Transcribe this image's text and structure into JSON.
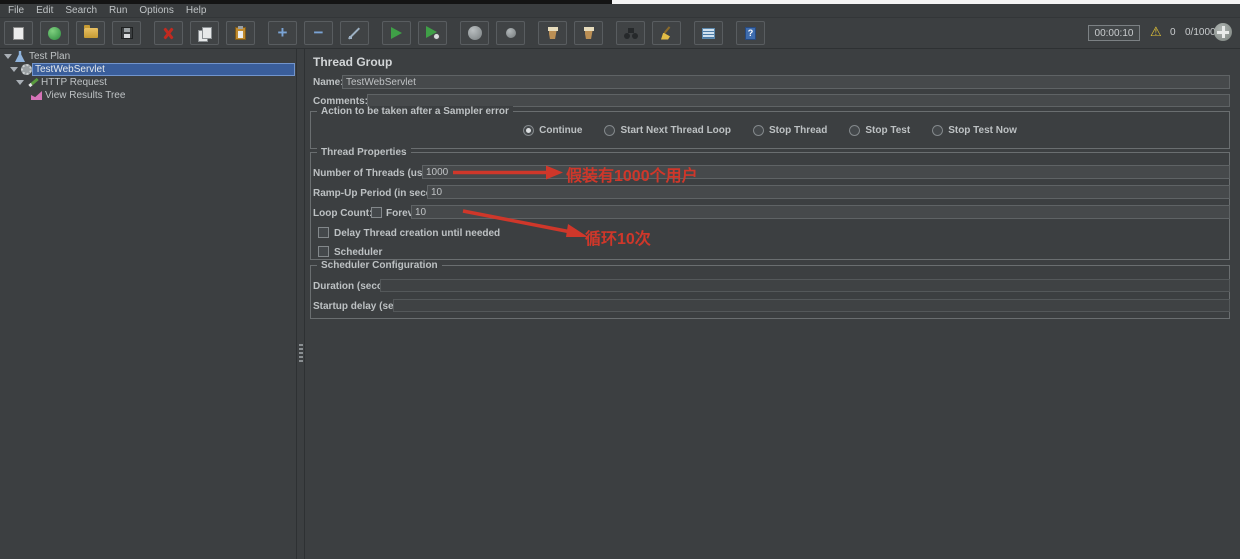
{
  "window": {
    "menu": {
      "items": [
        "File",
        "Edit",
        "Search",
        "Run",
        "Options",
        "Help"
      ]
    },
    "toolbar": {
      "buttons": [
        "new-plan",
        "templates",
        "open",
        "save",
        "cut",
        "copy",
        "paste",
        "expand-all",
        "collapse-all",
        "toggle",
        "start",
        "start-no-pauses",
        "stop",
        "shutdown",
        "clear",
        "clear-all",
        "search",
        "search-reset",
        "function-helper",
        "help"
      ],
      "timer": "00:00:10",
      "warning_count": "0",
      "thread_counter": "0/1000"
    }
  },
  "tree": {
    "items": [
      {
        "label": "Test Plan",
        "icon": "test-plan-icon",
        "selected": false
      },
      {
        "label": "TestWebServlet",
        "icon": "thread-group-icon",
        "selected": true
      },
      {
        "label": "HTTP Request",
        "icon": "http-request-icon",
        "selected": false
      },
      {
        "label": "View Results Tree",
        "icon": "view-results-tree-icon",
        "selected": false
      }
    ]
  },
  "main": {
    "title": "Thread Group",
    "name": {
      "label": "Name:",
      "value": "TestWebServlet"
    },
    "comments": {
      "label": "Comments:",
      "value": ""
    },
    "sampler_error": {
      "legend": "Action to be taken after a Sampler error",
      "options": [
        {
          "label": "Continue",
          "selected": true
        },
        {
          "label": "Start Next Thread Loop",
          "selected": false
        },
        {
          "label": "Stop Thread",
          "selected": false
        },
        {
          "label": "Stop Test",
          "selected": false
        },
        {
          "label": "Stop Test Now",
          "selected": false
        }
      ]
    },
    "thread_properties": {
      "legend": "Thread Properties",
      "num_threads": {
        "label": "Number of Threads (users):",
        "value": "1000"
      },
      "ramp_up": {
        "label": "Ramp-Up Period (in seconds):",
        "value": "10"
      },
      "loop_count": {
        "label": "Loop Count:",
        "forever_label": "Forever",
        "forever_checked": false,
        "value": "10"
      },
      "delay_label": "Delay Thread creation until needed",
      "delay_checked": false,
      "scheduler_label": "Scheduler",
      "scheduler_checked": false
    },
    "scheduler_config": {
      "legend": "Scheduler Configuration",
      "duration": {
        "label": "Duration (seconds)",
        "value": ""
      },
      "startup_delay": {
        "label": "Startup delay (seconds)",
        "value": ""
      }
    },
    "annotations": [
      {
        "text": "假装有1000个用户",
        "color": "#cf372a"
      },
      {
        "text": "循环10次",
        "color": "#cf372a"
      }
    ],
    "colors": {
      "annotation_red": "#cf372a",
      "selection_blue": "#3a5e9b",
      "warning_yellow": "#e6c637",
      "start_green": "#3f9f47"
    }
  }
}
